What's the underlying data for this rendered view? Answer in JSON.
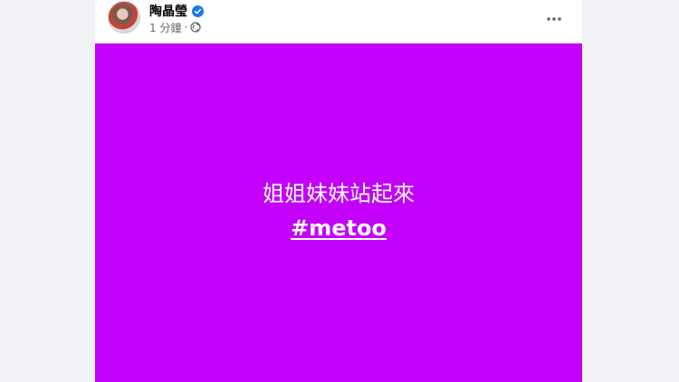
{
  "post": {
    "author": "陶晶瑩",
    "verified": true,
    "time": "1 分鐘",
    "separator": "·",
    "privacy_icon": "globe-icon",
    "more_icon": "more-horizontal-icon",
    "background_color": "#c200fa",
    "text_line": "姐姐妹妹站起來",
    "hashtag": "#metoo"
  },
  "colors": {
    "page_bg": "#f0f2f5",
    "verified_blue": "#1877f2",
    "meta_gray": "#65676b"
  }
}
